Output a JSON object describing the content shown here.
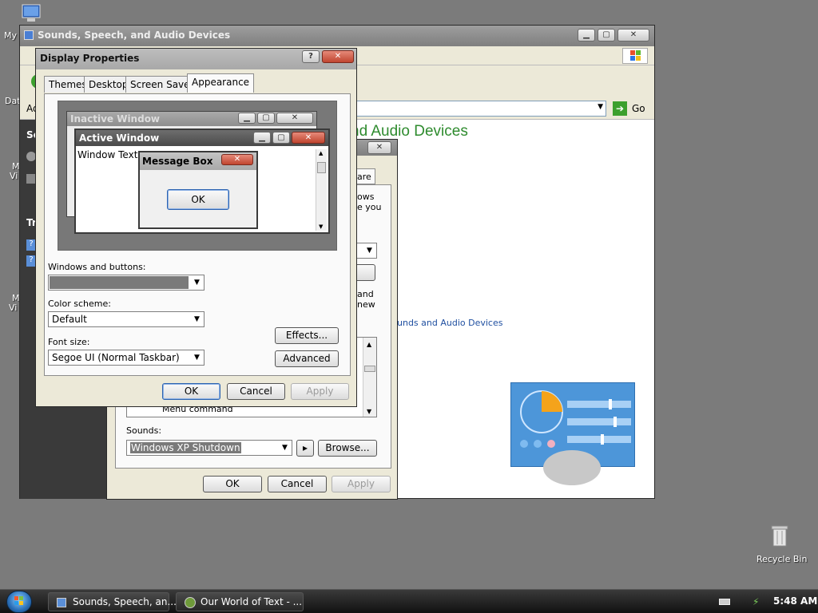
{
  "desktop": {
    "icons": [
      {
        "name": "my-computer",
        "label": "My"
      },
      {
        "name": "recycle-bin",
        "label": "Recycle Bin"
      }
    ],
    "clipped_labels": [
      "Dat",
      "M",
      "Vi",
      "M",
      "Vi"
    ]
  },
  "sounds_window": {
    "title": "Sounds, Speech, and Audio Devices",
    "go_label": "Go",
    "heading": "nd Audio Devices",
    "link": "unds and Audio Devices",
    "left_pane_clip": [
      "Ad",
      "Se",
      "Tr"
    ]
  },
  "sound_props_dialog": {
    "tab_clip": "are",
    "text_clip": [
      "ows",
      "e you",
      "and",
      "new"
    ],
    "list_item": "Menu command",
    "sounds_label": "Sounds:",
    "sounds_value": "Windows XP Shutdown",
    "browse_label": "Browse...",
    "ok_label": "OK",
    "cancel_label": "Cancel",
    "apply_label": "Apply"
  },
  "display_props": {
    "title": "Display Properties",
    "help_btn": "?",
    "tabs": [
      "Themes",
      "Desktop",
      "Screen Saver",
      "Appearance"
    ],
    "selected_tab": "Appearance",
    "preview": {
      "inactive_title": "Inactive Window",
      "active_title": "Active Window",
      "window_text": "Window Text",
      "msgbox_title": "Message Box",
      "msgbox_ok": "OK"
    },
    "windows_buttons_label": "Windows and buttons:",
    "windows_buttons_value": "",
    "color_scheme_label": "Color scheme:",
    "color_scheme_value": "Default",
    "font_size_label": "Font size:",
    "font_size_value": "Segoe UI (Normal Taskbar)",
    "effects_label": "Effects...",
    "advanced_label": "Advanced",
    "ok_label": "OK",
    "cancel_label": "Cancel",
    "apply_label": "Apply"
  },
  "taskbar": {
    "items": [
      {
        "label": "Sounds, Speech, an..."
      },
      {
        "label": "Our World of Text - ..."
      }
    ],
    "clock": "5:48 AM"
  },
  "colors": {
    "desktop": "#7b7b7b",
    "heading_green": "#2e8b2e",
    "link_blue": "#1f4fa0"
  }
}
